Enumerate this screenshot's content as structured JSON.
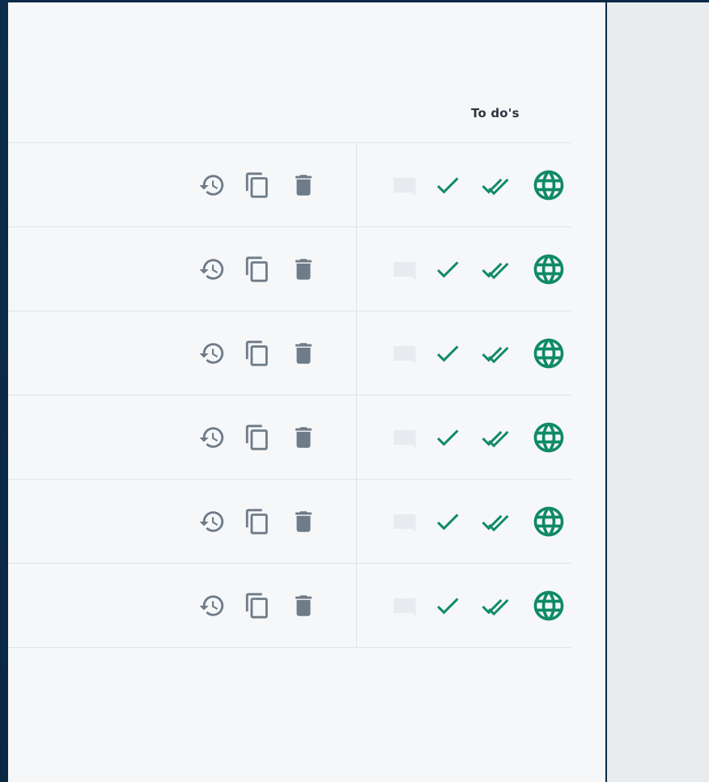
{
  "table": {
    "header_todos": "To do's",
    "rows": [
      {
        "actions": [
          "history-icon",
          "copy-icon",
          "trash-icon"
        ],
        "todos": [
          "comment-icon",
          "check-icon",
          "done-all-icon",
          "globe-icon"
        ]
      },
      {
        "actions": [
          "history-icon",
          "copy-icon",
          "trash-icon"
        ],
        "todos": [
          "comment-icon",
          "check-icon",
          "done-all-icon",
          "globe-icon"
        ]
      },
      {
        "actions": [
          "history-icon",
          "copy-icon",
          "trash-icon"
        ],
        "todos": [
          "comment-icon",
          "check-icon",
          "done-all-icon",
          "globe-icon"
        ]
      },
      {
        "actions": [
          "history-icon",
          "copy-icon",
          "trash-icon"
        ],
        "todos": [
          "comment-icon",
          "check-icon",
          "done-all-icon",
          "globe-icon"
        ]
      },
      {
        "actions": [
          "history-icon",
          "copy-icon",
          "trash-icon"
        ],
        "todos": [
          "comment-icon",
          "check-icon",
          "done-all-icon",
          "globe-icon"
        ]
      },
      {
        "actions": [
          "history-icon",
          "copy-icon",
          "trash-icon"
        ],
        "todos": [
          "comment-icon",
          "check-icon",
          "done-all-icon",
          "globe-icon"
        ]
      }
    ]
  },
  "colors": {
    "panel_bg": "#f6f7f9",
    "dark_frame": "#0b2a47",
    "side_bg": "#e9ecef",
    "icon_gray": "#6e7b88",
    "icon_green": "#0f8a67",
    "comment_gray": "#e7ebef",
    "border": "#dde3e8"
  }
}
